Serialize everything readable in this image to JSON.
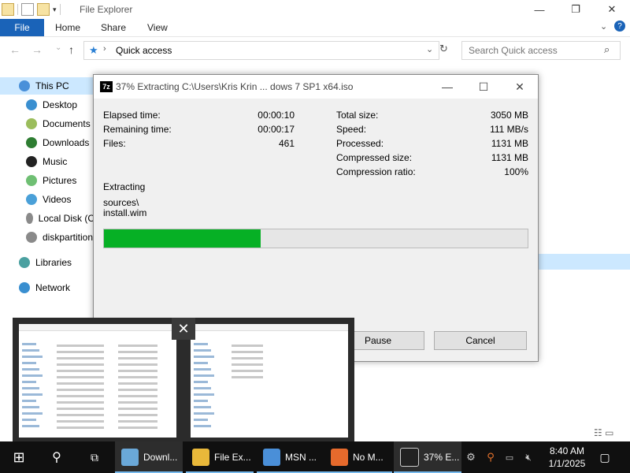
{
  "explorer": {
    "title": "File Explorer",
    "window_controls": [
      "—",
      "❐",
      "✕"
    ],
    "ribbon": {
      "file_tab": "File",
      "tabs": [
        "Home",
        "Share",
        "View"
      ]
    },
    "address": {
      "text": "Quick access",
      "search_placeholder": "Search Quick access"
    },
    "nav": {
      "items": [
        {
          "label": "This PC",
          "color": "#4a90d9"
        },
        {
          "label": "Desktop",
          "color": "#3a8fd0"
        },
        {
          "label": "Documents",
          "color": "#9bbd5c"
        },
        {
          "label": "Downloads",
          "color": "#2e7d32"
        },
        {
          "label": "Music",
          "color": "#222222"
        },
        {
          "label": "Pictures",
          "color": "#6fbf73"
        },
        {
          "label": "Videos",
          "color": "#4aa0d8"
        },
        {
          "label": "Local Disk (C",
          "color": "#8a8a8a"
        },
        {
          "label": "diskpartition",
          "color": "#8a8a8a"
        },
        {
          "label": "Libraries",
          "color": "#4aa0a0"
        },
        {
          "label": "Network",
          "color": "#3a8fd0"
        }
      ]
    }
  },
  "dialog": {
    "app_icon_text": "7z",
    "title": "37% Extracting C:\\Users\\Kris Krin ... dows 7 SP1 x64.iso",
    "left_stats": [
      {
        "label": "Elapsed time:",
        "value": "00:00:10"
      },
      {
        "label": "Remaining time:",
        "value": "00:00:17"
      },
      {
        "label": "Files:",
        "value": "461"
      }
    ],
    "right_stats": [
      {
        "label": "Total size:",
        "value": "3050 MB"
      },
      {
        "label": "Speed:",
        "value": "111 MB/s"
      },
      {
        "label": "Processed:",
        "value": "1131 MB"
      },
      {
        "label": "Compressed size:",
        "value": "1131 MB"
      },
      {
        "label": "Compression ratio:",
        "value": "100%"
      }
    ],
    "status_heading": "Extracting",
    "current_path_1": "sources\\",
    "current_path_2": "install.wim",
    "progress_fraction": 0.37,
    "pause_label": "Pause",
    "cancel_label": "Cancel"
  },
  "preview": {
    "close_glyph": "✕"
  },
  "taskbar": {
    "items": [
      {
        "label": "Downl...",
        "color": "#6aa8d8",
        "active": true
      },
      {
        "label": "File Ex...",
        "color": "#e8b83a",
        "active": false
      },
      {
        "label": "MSN ...",
        "color": "#4a8fd8",
        "active": false
      },
      {
        "label": "No M...",
        "color": "#e66a2c",
        "active": false
      },
      {
        "label": "37% E...",
        "color": "#222222",
        "active": true
      }
    ],
    "clock_time": "8:40 AM",
    "clock_date": "1/1/2025"
  },
  "colors": {
    "accent": "#1a63b8",
    "progress": "#06b025",
    "selection": "#cce8ff"
  }
}
